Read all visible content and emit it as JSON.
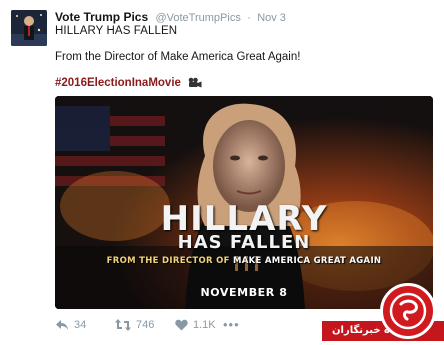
{
  "tweet": {
    "display_name": "Vote Trump Pics",
    "handle": "@VoteTrumpPics",
    "separator": "·",
    "time": "Nov 3",
    "line1": "HILLARY HAS FALLEN",
    "line2": "From the Director of Make America Great Again!",
    "hashtag": "#2016ElectionInaMovie"
  },
  "poster": {
    "title_line1": "HILLARY",
    "title_line2": "HAS FALLEN",
    "tagline_pre": "FROM THE DIRECTOR OF ",
    "tagline_em": "MAKE AMERICA GREAT AGAIN",
    "date": "NOVEMBER 8"
  },
  "actions": {
    "reply_count": "34",
    "retweet_count": "746",
    "like_count": "1.1K",
    "more": "•••"
  },
  "watermark": {
    "label": "باشگاه خبرنگاران"
  },
  "colors": {
    "hashtag": "#8b1a1a",
    "meta_gray": "#8899a6",
    "watermark_red": "#c4161c"
  }
}
